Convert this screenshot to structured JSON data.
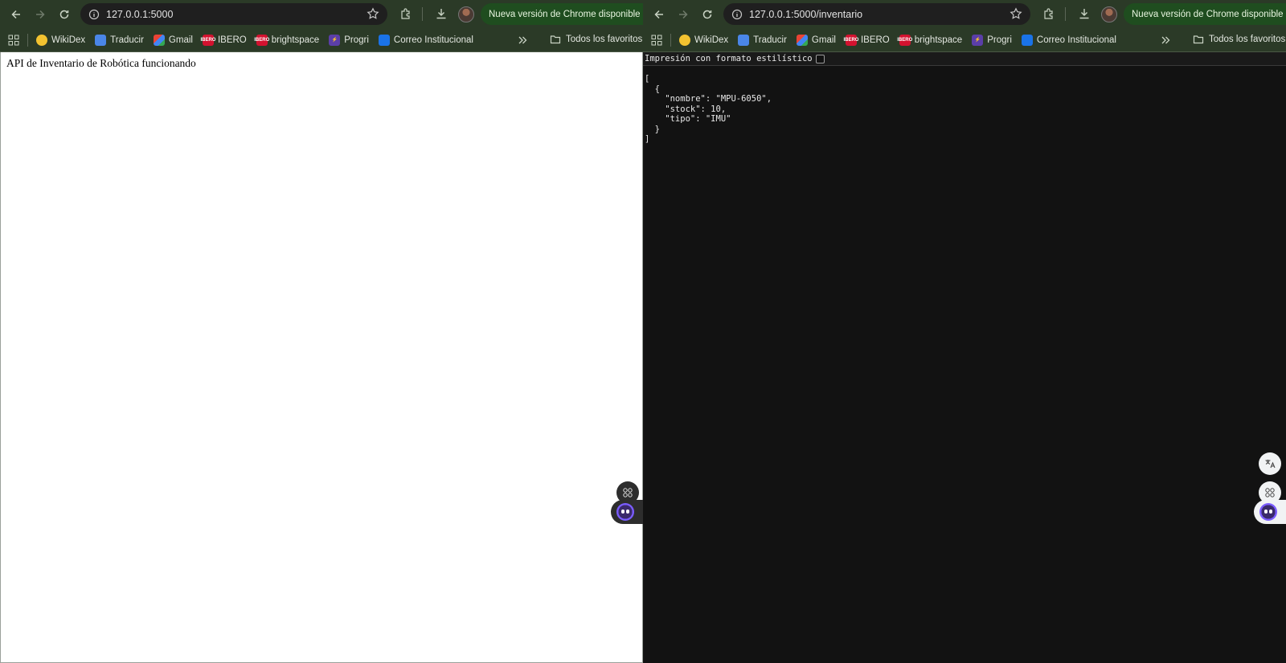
{
  "left": {
    "url": "127.0.0.1:5000",
    "update_label": "Nueva versión de Chrome disponible",
    "bookmarks": [
      "WikiDex",
      "Traducir",
      "Gmail",
      "IBERO",
      "brightspace",
      "Progri",
      "Correo Institucional"
    ],
    "all_bookmarks": "Todos los favoritos",
    "page_text": "API de Inventario de Robótica funcionando"
  },
  "right": {
    "url": "127.0.0.1:5000/inventario",
    "update_label": "Nueva versión de Chrome disponible",
    "bookmarks": [
      "WikiDex",
      "Traducir",
      "Gmail",
      "IBERO",
      "brightspace",
      "Progri",
      "Correo Institucional"
    ],
    "all_bookmarks": "Todos los favoritos",
    "pretty_print_label": "Impresión con formato estilístico",
    "json_text": "[\n  {\n    \"nombre\": \"MPU-6050\",\n    \"stock\": 10,\n    \"tipo\": \"IMU\"\n  }\n]"
  },
  "favicon_labels": {
    "ibero": "IBERO"
  },
  "icons": [
    "back-icon",
    "forward-icon",
    "reload-icon",
    "site-info-icon",
    "star-icon",
    "extensions-icon",
    "download-icon",
    "kebab-icon",
    "apps-icon",
    "chevron-double-icon",
    "folder-icon",
    "translate-icon",
    "shortcut-icon",
    "bot-icon"
  ]
}
